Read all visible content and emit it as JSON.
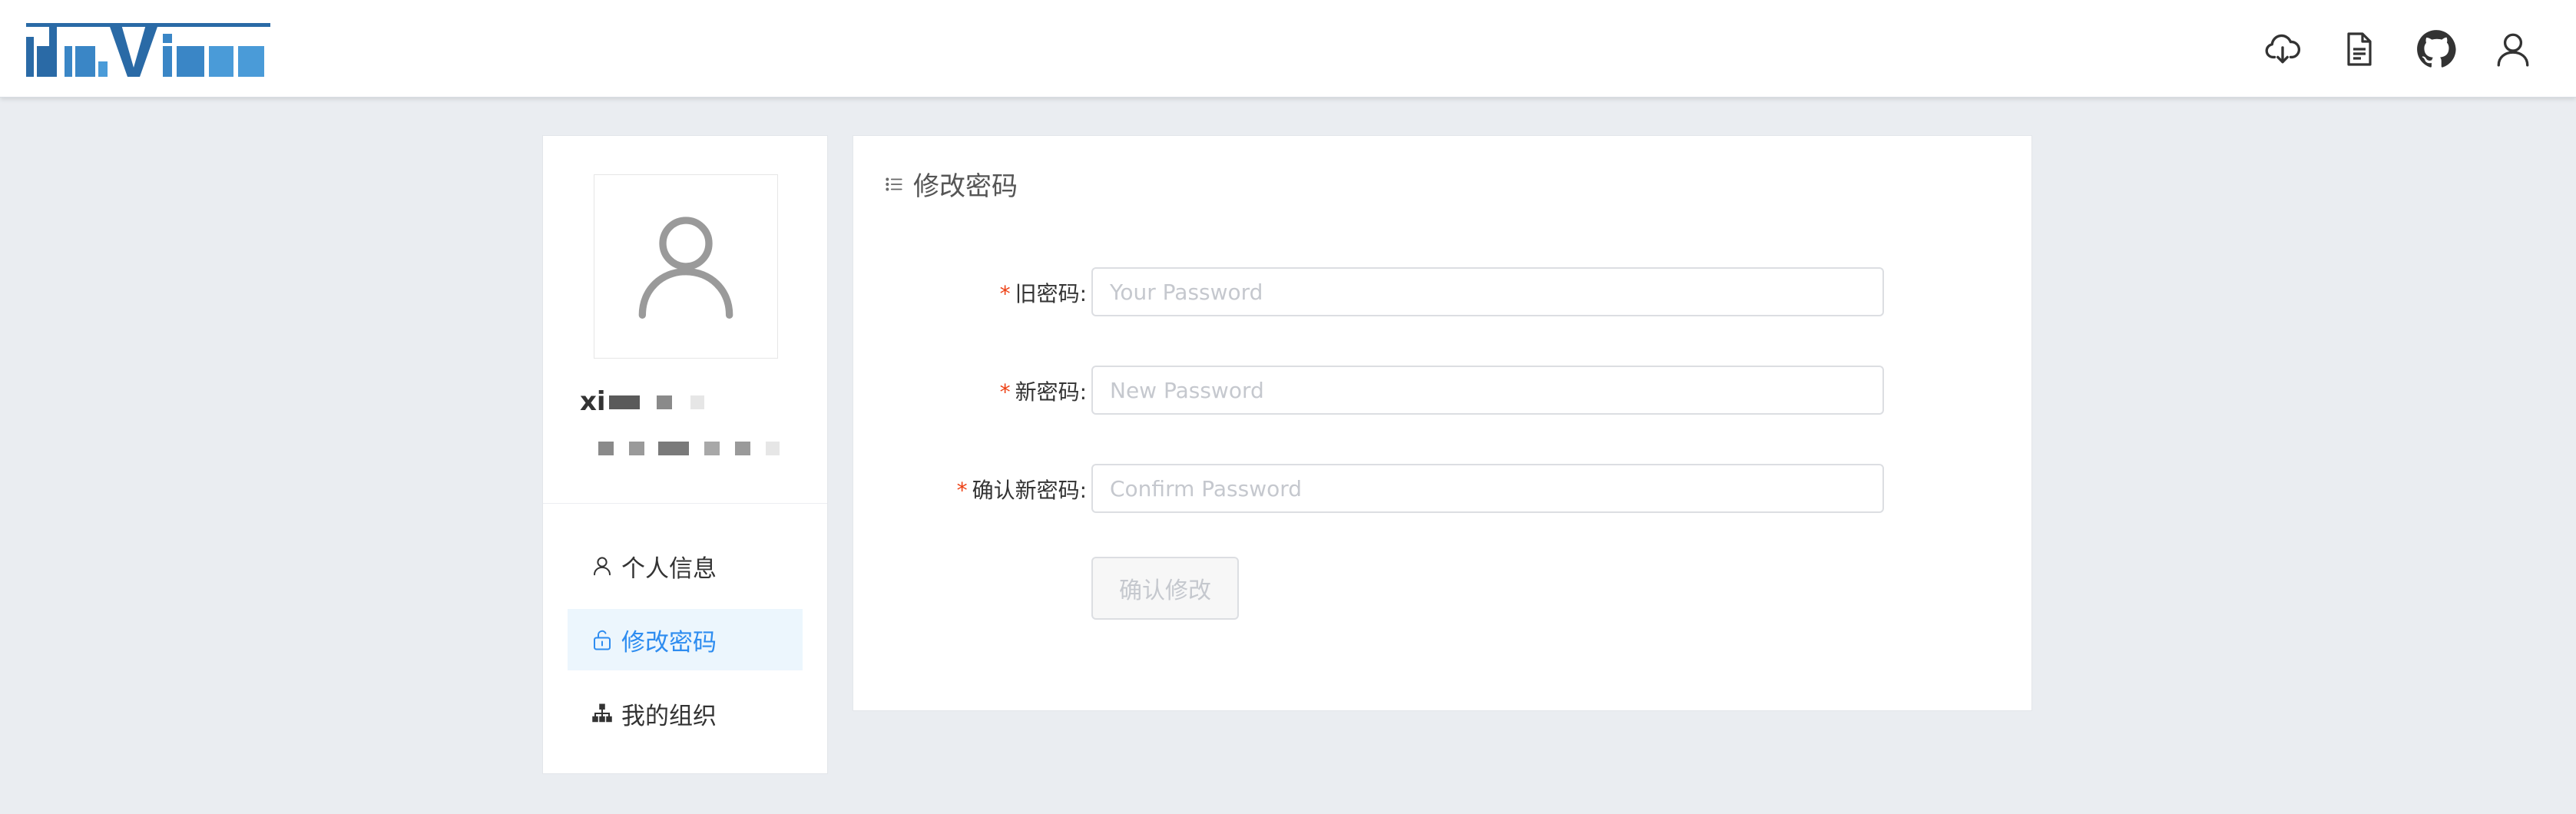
{
  "header": {
    "icons": [
      "cloud-download-icon",
      "document-icon",
      "github-icon",
      "user-icon"
    ]
  },
  "sidebar": {
    "username": "xi",
    "menu": [
      {
        "label": "个人信息",
        "icon": "user-icon",
        "active": false
      },
      {
        "label": "修改密码",
        "icon": "lock-icon",
        "active": true
      },
      {
        "label": "我的组织",
        "icon": "org-icon",
        "active": false
      }
    ]
  },
  "form": {
    "title": "修改密码",
    "fields": [
      {
        "label": "旧密码:",
        "placeholder": "Your Password",
        "value": ""
      },
      {
        "label": "新密码:",
        "placeholder": "New Password",
        "value": ""
      },
      {
        "label": "确认新密码:",
        "placeholder": "Confirm Password",
        "value": ""
      }
    ],
    "submit_label": "确认修改",
    "required_mark": "*"
  },
  "colors": {
    "accent": "#2d8cf0",
    "active_bg": "#ecf6fd",
    "required": "#ed4014",
    "logo_dark": "#2a6aa6",
    "logo_light": "#4a9bd8"
  }
}
